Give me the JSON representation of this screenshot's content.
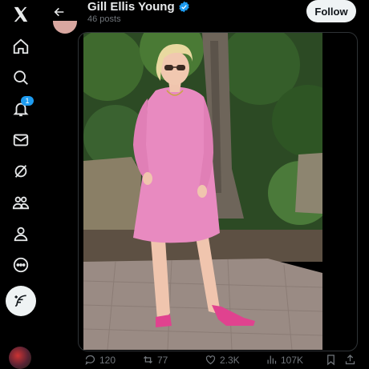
{
  "header": {
    "name": "Gill Ellis Young",
    "posts": "46 posts",
    "follow_label": "Follow"
  },
  "nav": {
    "notifications_count": "1",
    "items": [
      "x-logo-icon",
      "home-icon",
      "explore-icon",
      "notifications-icon",
      "messages-icon",
      "grok-icon",
      "communities-icon",
      "profile-icon",
      "more-icon"
    ]
  },
  "actions": {
    "replies": "120",
    "reposts": "77",
    "likes": "2.3K",
    "views": "107K"
  },
  "colors": {
    "accent": "#1d9bf0",
    "background": "#000000",
    "muted_text": "#71767b",
    "dress": "#e88ac0",
    "shoes": "#e0428f"
  }
}
